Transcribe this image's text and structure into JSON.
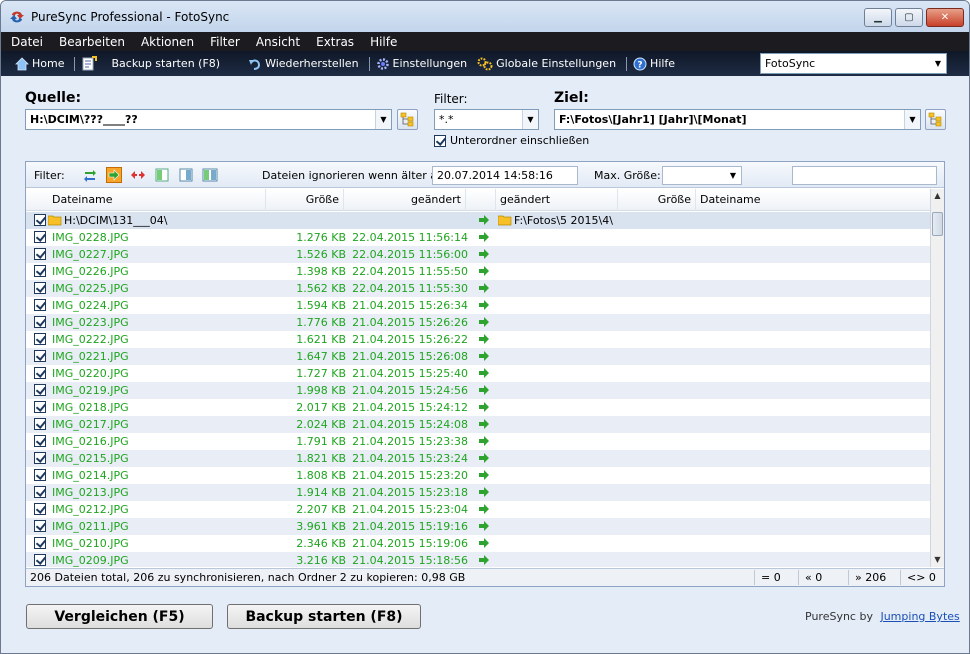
{
  "window": {
    "title": "PureSync Professional  -  FotoSync"
  },
  "menu": [
    "Datei",
    "Bearbeiten",
    "Aktionen",
    "Filter",
    "Ansicht",
    "Extras",
    "Hilfe"
  ],
  "toolbar": {
    "home": "Home",
    "backup": "Backup starten  (F8)",
    "restore": "Wiederherstellen",
    "settings": "Einstellungen",
    "global_settings": "Globale Einstellungen",
    "help": "Hilfe",
    "profile": "FotoSync"
  },
  "source": {
    "label": "Quelle:",
    "value": "H:\\DCIM\\???____??"
  },
  "filter": {
    "label": "Filter:",
    "value": "*.*",
    "subfolders_label": "Unterordner einschließen",
    "subfolders_checked": true
  },
  "target": {
    "label": "Ziel:",
    "value": "F:\\Fotos\\[Jahr1] [Jahr]\\[Monat]"
  },
  "filterbar": {
    "label": "Filter:",
    "ignore_label": "Dateien ignorieren wenn älter als:",
    "ignore_date": "20.07.2014 14:58:16",
    "max_size_label": "Max. Größe:",
    "max_size_value": ""
  },
  "columns": {
    "left_name": "Dateiname",
    "left_size": "Größe",
    "left_changed": "geändert",
    "right_changed": "geändert",
    "right_size": "Größe",
    "right_name": "Dateiname"
  },
  "folder_row": {
    "left": "H:\\DCIM\\131___04\\",
    "right": "F:\\Fotos\\5 2015\\4\\"
  },
  "files": [
    {
      "name": "IMG_0228.JPG",
      "size": "1.276 KB",
      "date": "22.04.2015 11:56:14"
    },
    {
      "name": "IMG_0227.JPG",
      "size": "1.526 KB",
      "date": "22.04.2015 11:56:00"
    },
    {
      "name": "IMG_0226.JPG",
      "size": "1.398 KB",
      "date": "22.04.2015 11:55:50"
    },
    {
      "name": "IMG_0225.JPG",
      "size": "1.562 KB",
      "date": "22.04.2015 11:55:30"
    },
    {
      "name": "IMG_0224.JPG",
      "size": "1.594 KB",
      "date": "21.04.2015 15:26:34"
    },
    {
      "name": "IMG_0223.JPG",
      "size": "1.776 KB",
      "date": "21.04.2015 15:26:26"
    },
    {
      "name": "IMG_0222.JPG",
      "size": "1.621 KB",
      "date": "21.04.2015 15:26:22"
    },
    {
      "name": "IMG_0221.JPG",
      "size": "1.647 KB",
      "date": "21.04.2015 15:26:08"
    },
    {
      "name": "IMG_0220.JPG",
      "size": "1.727 KB",
      "date": "21.04.2015 15:25:40"
    },
    {
      "name": "IMG_0219.JPG",
      "size": "1.998 KB",
      "date": "21.04.2015 15:24:56"
    },
    {
      "name": "IMG_0218.JPG",
      "size": "2.017 KB",
      "date": "21.04.2015 15:24:12"
    },
    {
      "name": "IMG_0217.JPG",
      "size": "2.024 KB",
      "date": "21.04.2015 15:24:08"
    },
    {
      "name": "IMG_0216.JPG",
      "size": "1.791 KB",
      "date": "21.04.2015 15:23:38"
    },
    {
      "name": "IMG_0215.JPG",
      "size": "1.821 KB",
      "date": "21.04.2015 15:23:24"
    },
    {
      "name": "IMG_0214.JPG",
      "size": "1.808 KB",
      "date": "21.04.2015 15:23:20"
    },
    {
      "name": "IMG_0213.JPG",
      "size": "1.914 KB",
      "date": "21.04.2015 15:23:18"
    },
    {
      "name": "IMG_0212.JPG",
      "size": "2.207 KB",
      "date": "21.04.2015 15:23:04"
    },
    {
      "name": "IMG_0211.JPG",
      "size": "3.961 KB",
      "date": "21.04.2015 15:19:16"
    },
    {
      "name": "IMG_0210.JPG",
      "size": "2.346 KB",
      "date": "21.04.2015 15:19:06"
    },
    {
      "name": "IMG_0209.JPG",
      "size": "3.216 KB",
      "date": "21.04.2015 15:18:56"
    }
  ],
  "status": {
    "text": "206 Dateien total,  206 zu synchronisieren,  nach Ordner 2 zu kopieren: 0,98 GB",
    "equal": "= 0",
    "left": "« 0",
    "right": "» 206",
    "diff": "<> 0"
  },
  "buttons": {
    "compare": "Vergleichen (F5)",
    "backup": "Backup starten  (F8)"
  },
  "brand": {
    "prefix": "PureSync by",
    "link": "Jumping Bytes"
  },
  "colors": {
    "new_file": "#1fa51f",
    "arrow": "#2fa32f",
    "toolbar_bg": "#16213a"
  }
}
